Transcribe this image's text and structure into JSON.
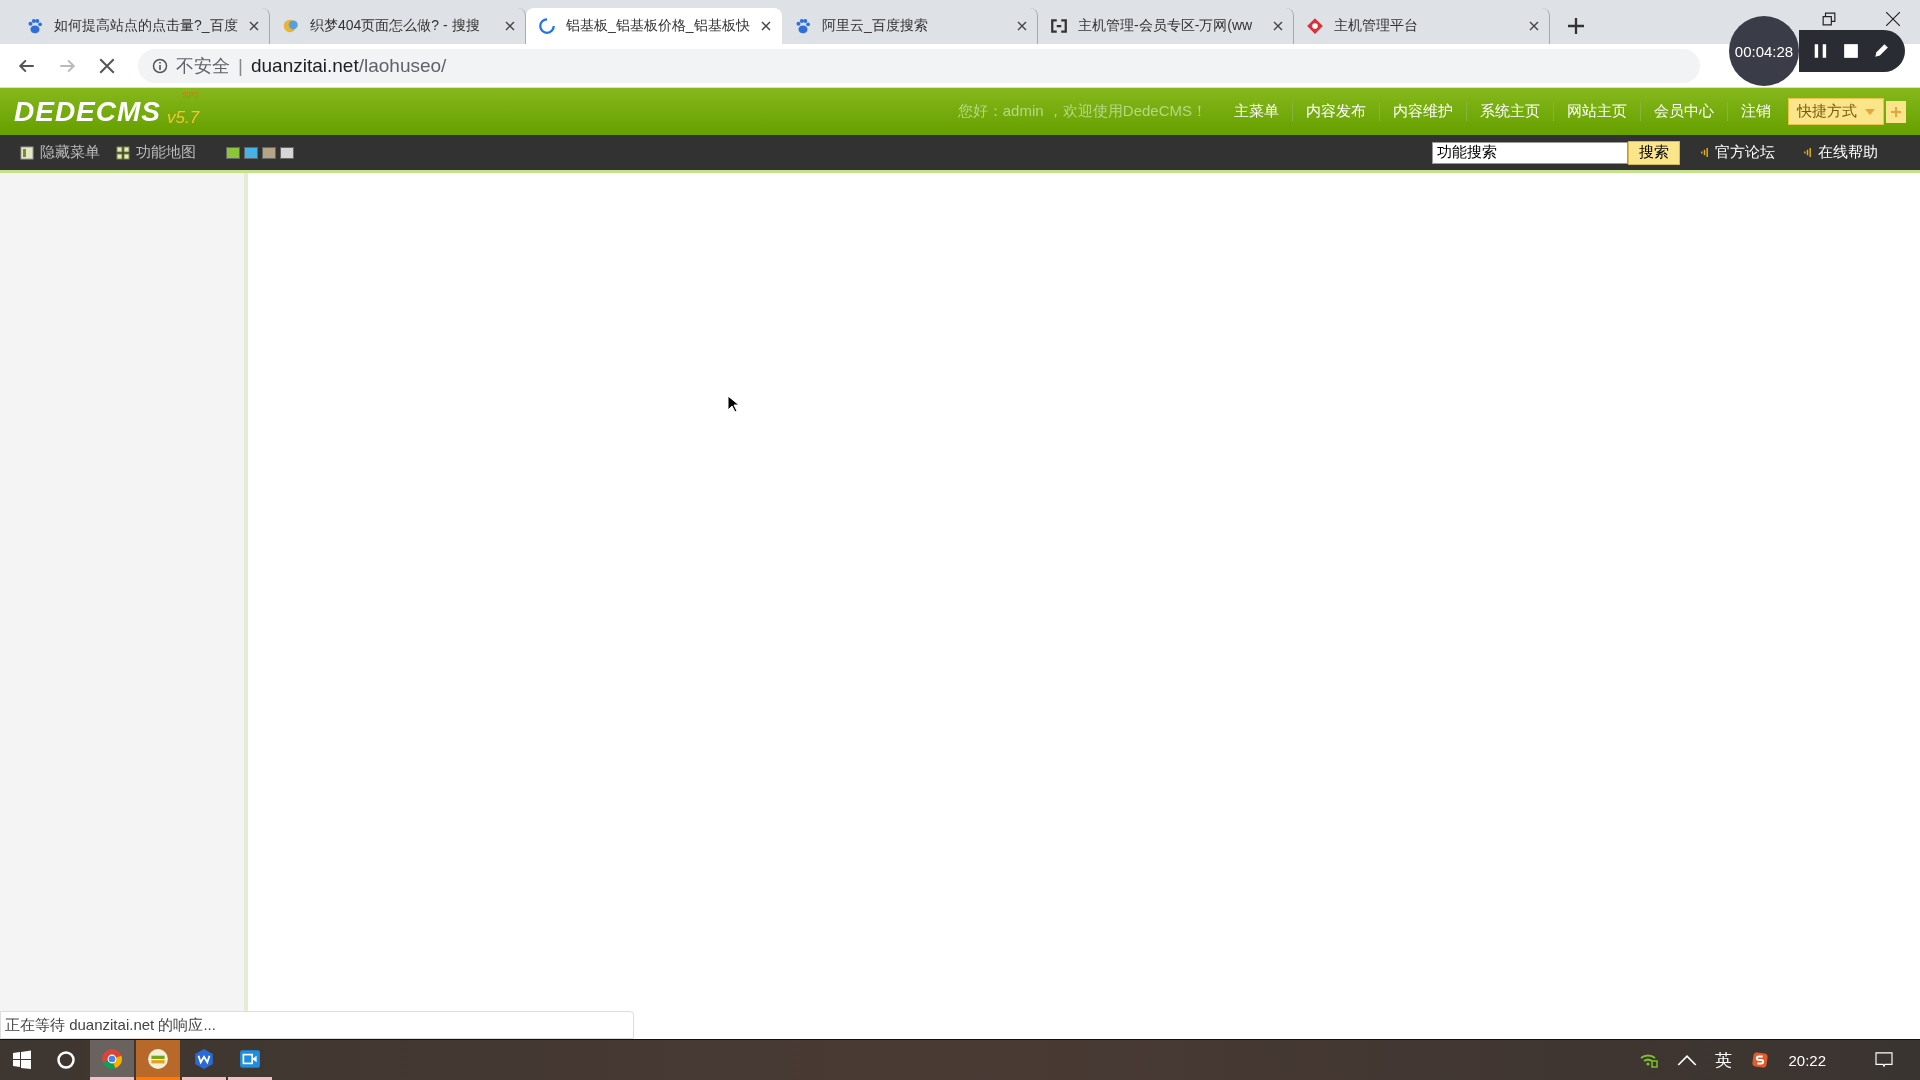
{
  "tabs": [
    {
      "title": "如何提高站点的点击量?_百度",
      "kind": "paw",
      "selected": false,
      "loading": false
    },
    {
      "title": "织梦404页面怎么做? - 搜搜",
      "kind": "bubble",
      "selected": false,
      "loading": false
    },
    {
      "title": "铝基板_铝基板价格_铝基板快",
      "selected": true,
      "loading": true
    },
    {
      "title": "阿里云_百度搜索",
      "kind": "paw",
      "selected": false,
      "loading": false
    },
    {
      "title": "主机管理-会员专区-万网(ww",
      "kind": "bracket",
      "selected": false,
      "loading": false
    },
    {
      "title": "主机管理平台",
      "kind": "diamond",
      "selected": false,
      "loading": false
    }
  ],
  "address_bar": {
    "security": "不安全",
    "separator": "|",
    "host": "duanzitai.net",
    "path": "/laohuseo/"
  },
  "recorder": {
    "time": "00:04:28"
  },
  "header": {
    "logo": "DEDECMS",
    "version": "v5.7",
    "edition": "SP2",
    "greeting": "您好：admin ，欢迎使用DedeCMS！",
    "nav": [
      "主菜单",
      "内容发布",
      "内容维护",
      "系统主页",
      "网站主页",
      "会员中心",
      "注销"
    ],
    "quick": "快捷方式"
  },
  "toolbar": {
    "hide_menu": "隐藏菜单",
    "site_map": "功能地图",
    "skins": [
      {
        "color": "#8cc43a"
      },
      {
        "color": "#46b3e6"
      },
      {
        "color": "#b6a489"
      },
      {
        "color": "#d6d6d6"
      }
    ],
    "search": {
      "value": "功能搜索",
      "button": "搜索"
    },
    "links": [
      "官方论坛",
      "在线帮助"
    ]
  },
  "status": "正在等待 duanzitai.net 的响应...",
  "taskbar": {
    "apps": [
      {
        "kind": "chrome",
        "active": true
      },
      {
        "kind": "dede",
        "active": true
      },
      {
        "kind": "wps",
        "active": false
      },
      {
        "kind": "video",
        "active": false
      }
    ],
    "language": "英",
    "time": "20:22"
  }
}
